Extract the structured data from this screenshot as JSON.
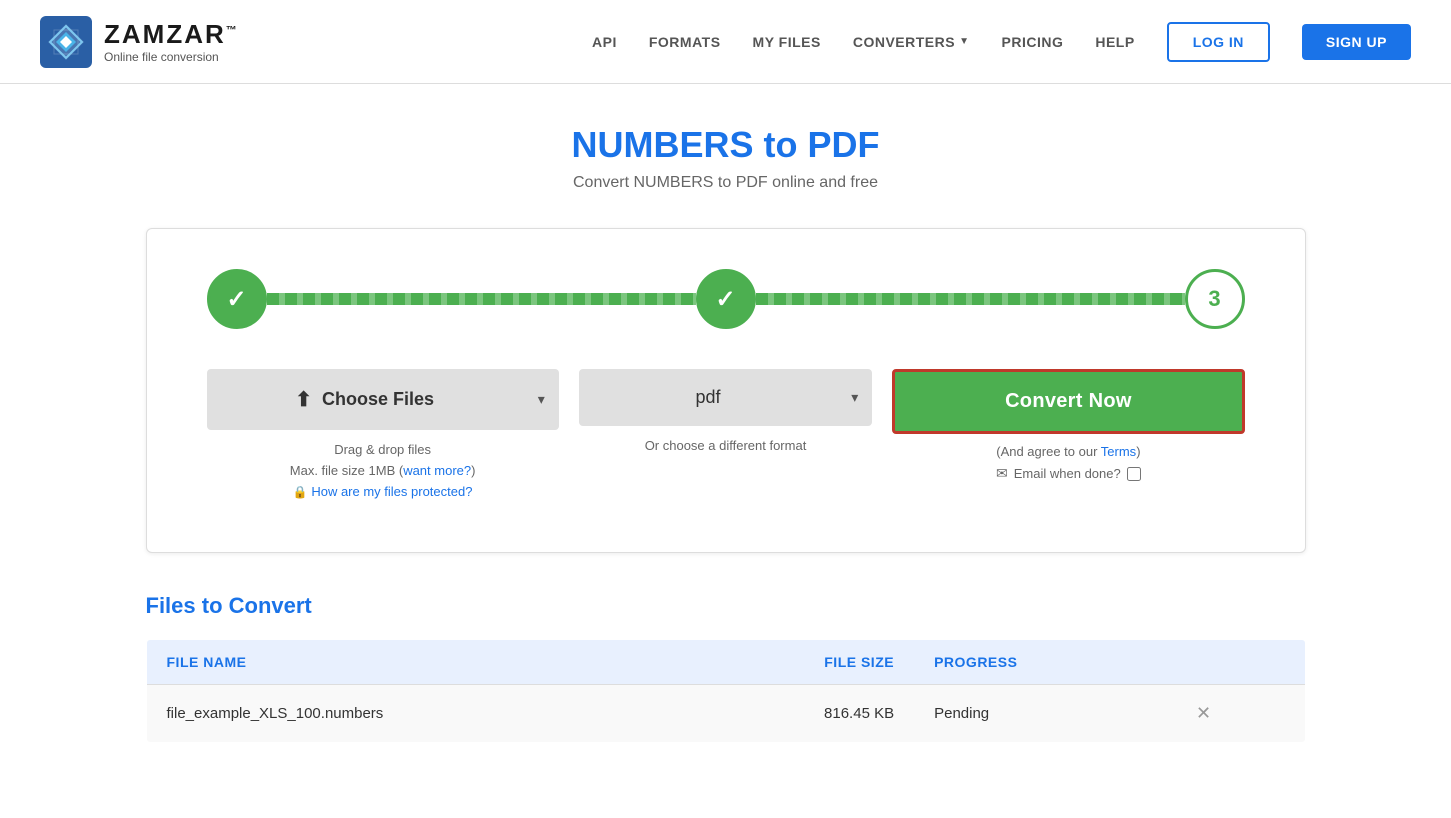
{
  "header": {
    "logo_name": "ZAMZAR",
    "logo_tm": "™",
    "logo_tagline": "Online file conversion",
    "nav": {
      "api": "API",
      "formats": "FORMATS",
      "my_files": "MY FILES",
      "converters": "CONVERTERS",
      "pricing": "PRICING",
      "help": "HELP",
      "login": "LOG IN",
      "signup": "SIGN UP"
    }
  },
  "page": {
    "title": "NUMBERS to PDF",
    "subtitle": "Convert NUMBERS to PDF online and free"
  },
  "steps": {
    "step1_label": "✓",
    "step2_label": "✓",
    "step3_label": "3"
  },
  "controls": {
    "choose_files": "Choose Files",
    "choose_files_icon": "⬆",
    "format_value": "pdf",
    "convert_now": "Convert Now",
    "drag_drop": "Drag & drop files",
    "max_size": "Max. file size 1MB (",
    "want_more": "want more?",
    "want_more_close": ")",
    "files_protected": "How are my files protected?",
    "or_choose_format": "Or choose a different format",
    "agree_terms_pre": "(And agree to our ",
    "terms_link": "Terms",
    "agree_terms_post": ")",
    "email_label": "Email when done?",
    "email_icon": "✉"
  },
  "files_section": {
    "heading_pre": "Files to ",
    "heading_highlight": "Convert",
    "col_filename": "FILE NAME",
    "col_filesize": "FILE SIZE",
    "col_progress": "PROGRESS",
    "rows": [
      {
        "filename": "file_example_XLS_100.numbers",
        "filesize": "816.45 KB",
        "progress": "Pending"
      }
    ]
  }
}
